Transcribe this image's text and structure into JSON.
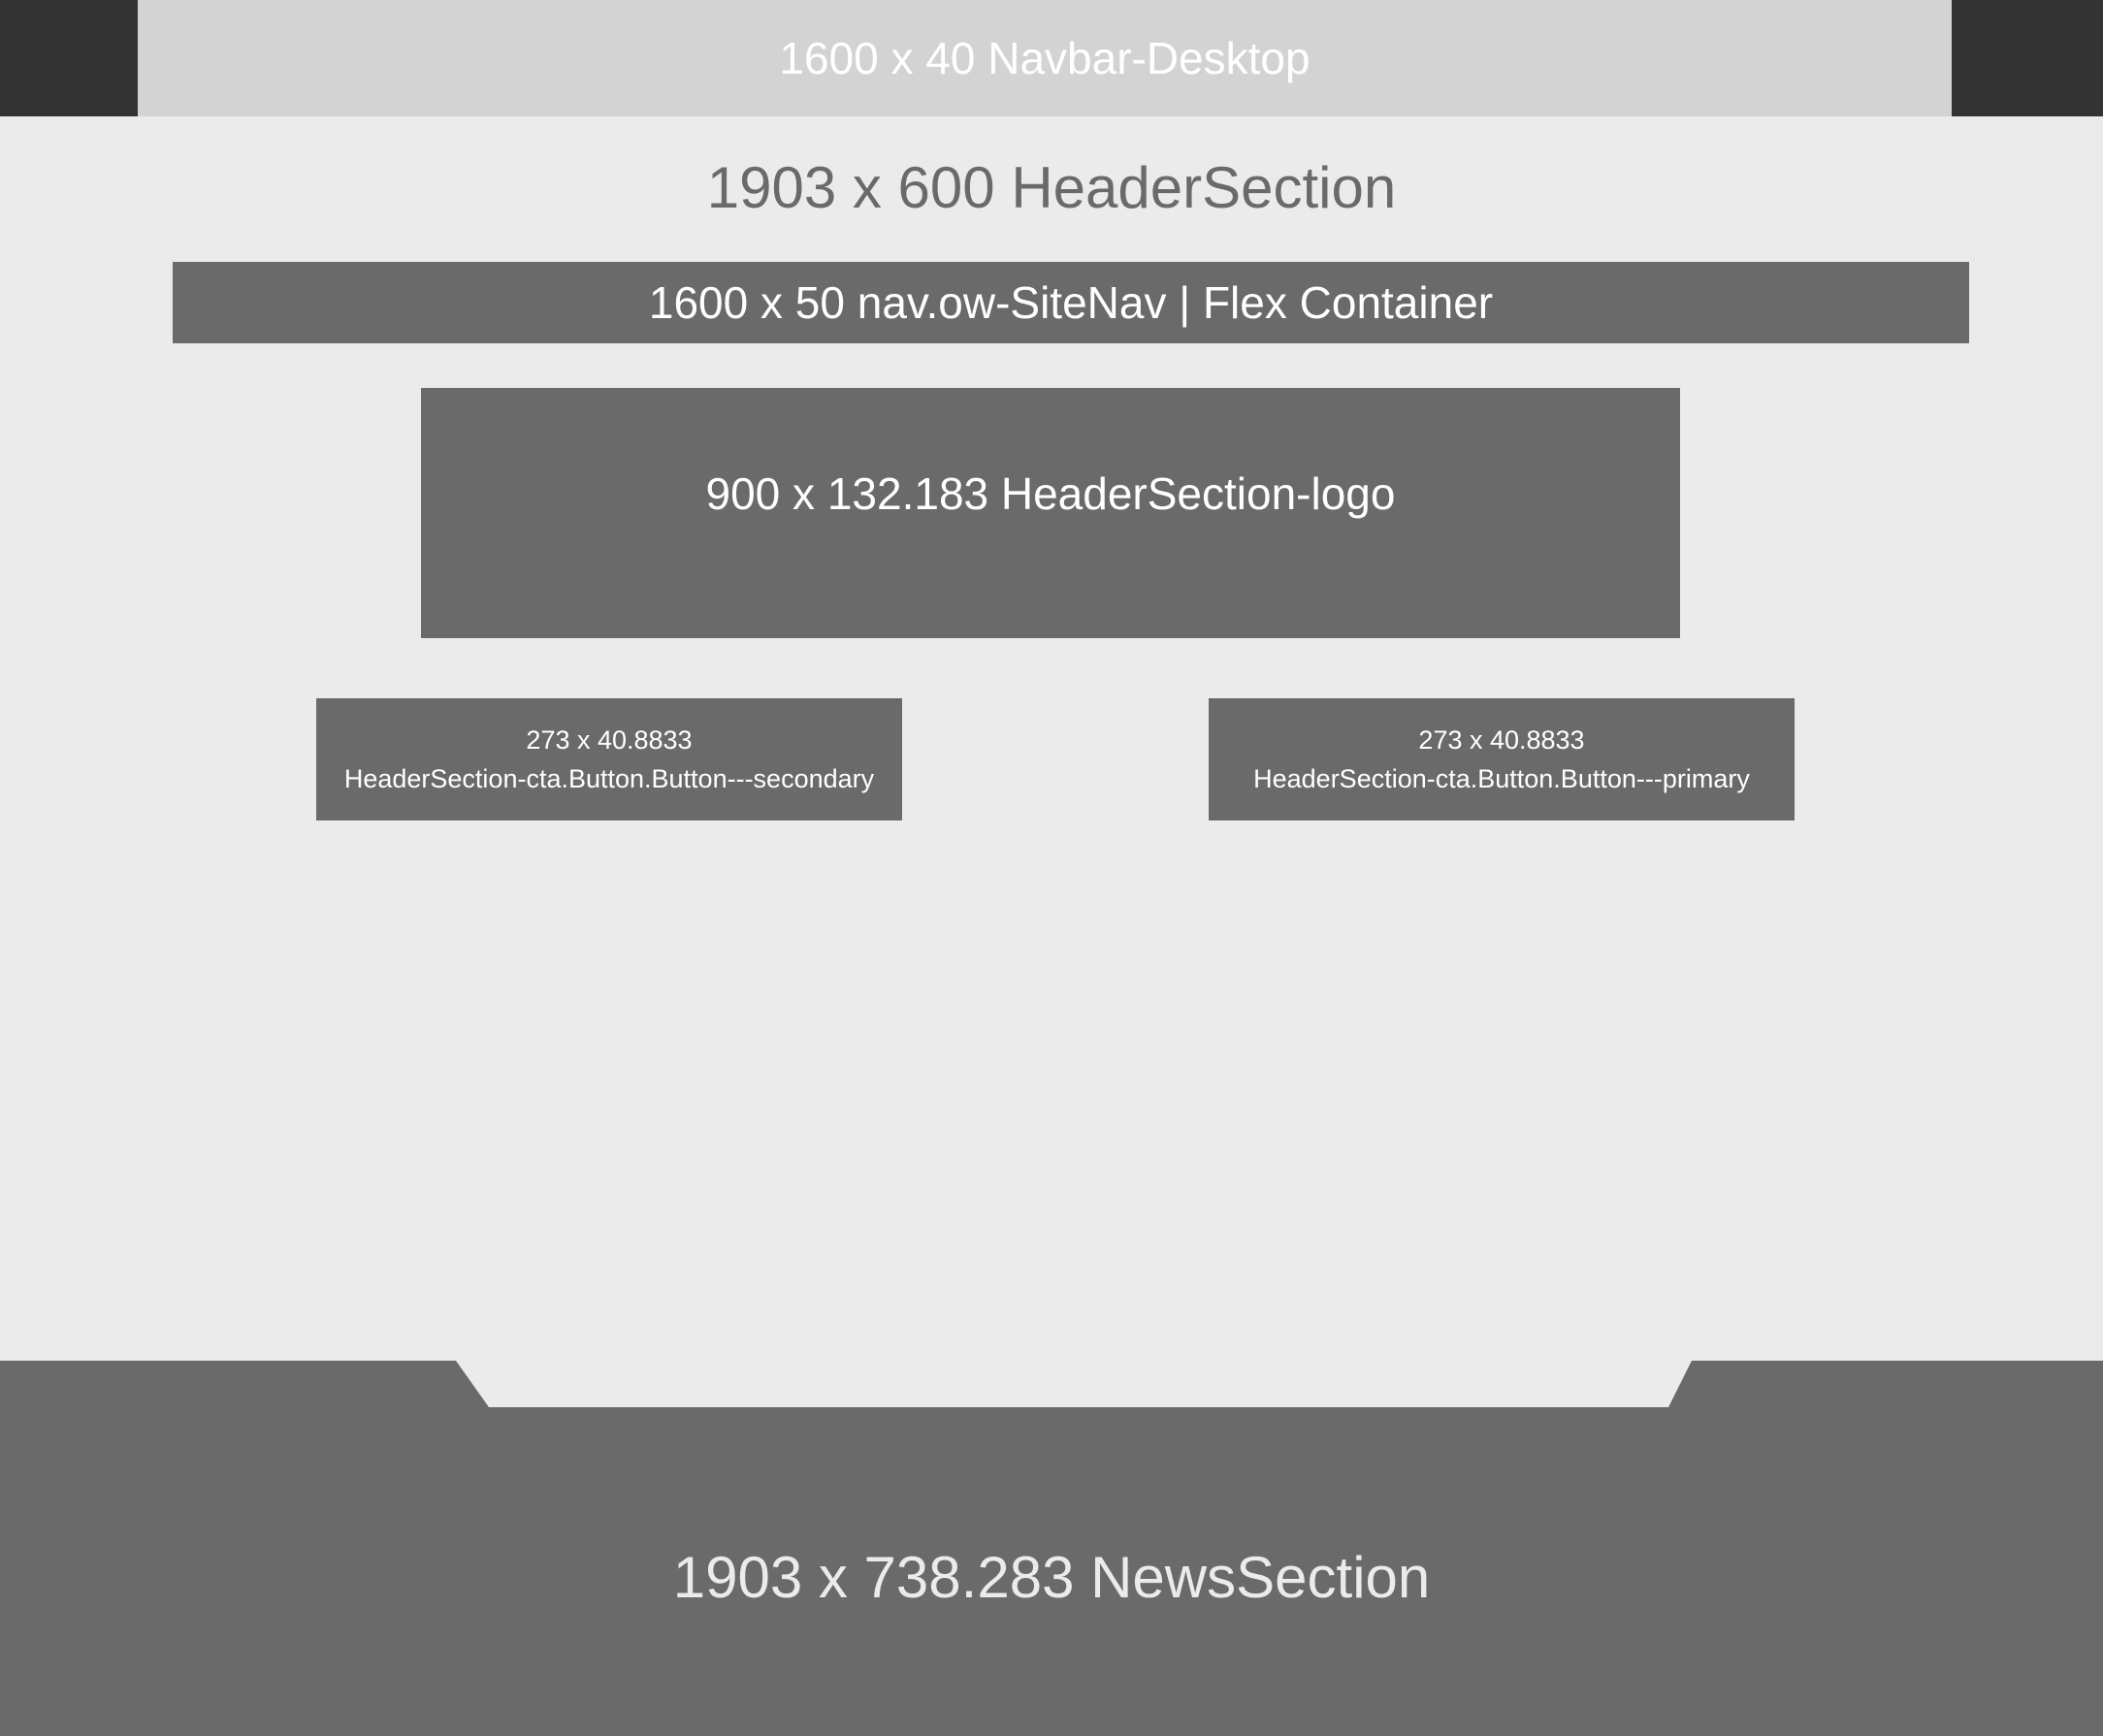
{
  "navbar": {
    "label": "1600 x 40 Navbar-Desktop"
  },
  "header_section": {
    "label": "1903 x 600 HeaderSection",
    "site_nav": {
      "label": "1600 x 50 nav.ow-SiteNav | Flex Container"
    },
    "logo": {
      "label": "900 x 132.183 HeaderSection-logo"
    },
    "cta_secondary": {
      "size": "273 x 40.8833",
      "name": "HeaderSection-cta.Button.Button---secondary"
    },
    "cta_primary": {
      "size": "273 x 40.8833",
      "name": "HeaderSection-cta.Button.Button---primary"
    }
  },
  "news_section": {
    "label": "1903 x 738.283 NewsSection"
  },
  "colors": {
    "background": "#ebebeb",
    "topbar": "#333333",
    "navbar": "#d3d3d3",
    "box": "#6a6a6a",
    "text_light": "#ffffff",
    "text_muted": "#6a6a6a"
  }
}
